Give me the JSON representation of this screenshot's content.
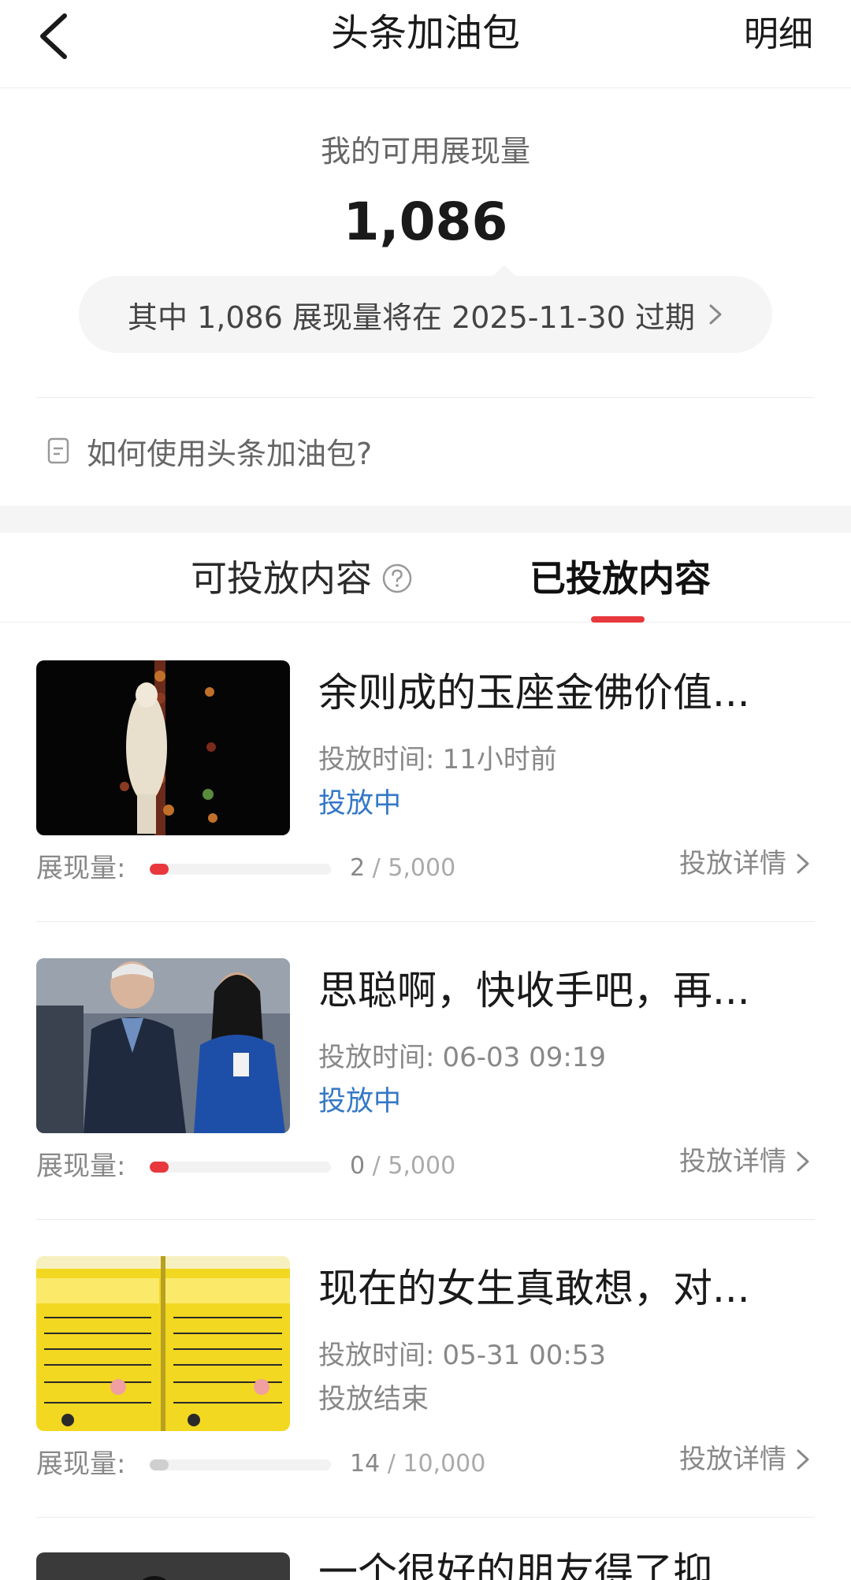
{
  "header": {
    "back_icon": "chevron-left-icon",
    "title": "头条加油包",
    "detail_label": "明细"
  },
  "summary": {
    "label": "我的可用展现量",
    "value": "1,086",
    "expire_text": "其中 1,086 展现量将在 2025-11-30 过期"
  },
  "howto": {
    "icon": "document-icon",
    "label": "如何使用头条加油包?"
  },
  "tabs": [
    {
      "label": "可投放内容",
      "icon": "question-circle-icon",
      "selected": false
    },
    {
      "label": "已投放内容",
      "selected": true
    }
  ],
  "colors": {
    "accent": "#e8383d",
    "active_status": "#3478c6",
    "ended_bar": "#cfcfcf"
  },
  "items": [
    {
      "title": "余则成的玉座金佛价值...",
      "time_prefix": "投放时间:",
      "time": "11小时前",
      "status": "投放中",
      "status_type": "active",
      "impressions_label": "展现量:",
      "impressions_current": "2",
      "impressions_total": "/ 5,000",
      "progress_fraction": 0.0004,
      "detail_label": "投放详情"
    },
    {
      "title": "思聪啊，快收手吧，再...",
      "time_prefix": "投放时间:",
      "time": "06-03 09:19",
      "status": "投放中",
      "status_type": "active",
      "impressions_label": "展现量:",
      "impressions_current": "0",
      "impressions_total": "/ 5,000",
      "progress_fraction": 0.0,
      "detail_label": "投放详情"
    },
    {
      "title": "现在的女生真敢想，对...",
      "time_prefix": "投放时间:",
      "time": "05-31 00:53",
      "status": "投放结束",
      "status_type": "ended",
      "impressions_label": "展现量:",
      "impressions_current": "14",
      "impressions_total": "/ 10,000",
      "progress_fraction": 0.0014,
      "detail_label": "投放详情"
    },
    {
      "title": "一个很好的朋友得了抑"
    }
  ]
}
